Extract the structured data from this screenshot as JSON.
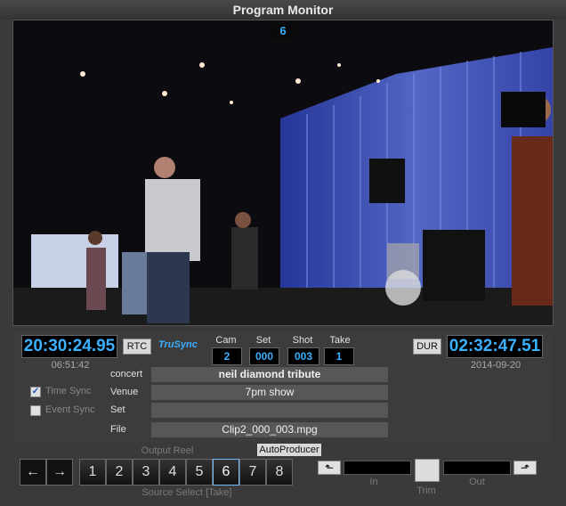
{
  "window": {
    "title": "Program Monitor"
  },
  "video": {
    "active_camera": "6"
  },
  "timecode": {
    "current": "20:30:24.95",
    "elapsed": "06:51:42",
    "rtc_label": "RTC",
    "trusync_label": "TruSync",
    "dur_label": "DUR",
    "duration": "02:32:47.51",
    "date": "2014-09-20"
  },
  "take": {
    "cam_label": "Cam",
    "cam": "2",
    "set_label": "Set",
    "set": "000",
    "shot_label": "Shot",
    "shot": "003",
    "take_label": "Take",
    "take": "1"
  },
  "metadata": {
    "concert_label": "concert",
    "concert": "neil diamond tribute",
    "venue_label": "Venue",
    "venue": "7pm show",
    "set_label": "Set",
    "set": "",
    "file_label": "File",
    "file": "Clip2_000_003.mpg"
  },
  "sync": {
    "time_sync_label": "Time Sync",
    "time_sync_checked": true,
    "event_sync_label": "Event Sync",
    "event_sync_checked": false
  },
  "controls": {
    "prev_glyph": "←",
    "next_glyph": "→",
    "output_reel_label": "Output Reel",
    "autoproducer_label": "AutoProducer",
    "source_select_label": "Source Select [Take]",
    "sources": [
      "1",
      "2",
      "3",
      "4",
      "5",
      "6",
      "7",
      "8"
    ],
    "active_source": "6",
    "in_label": "In",
    "trim_label": "Trim",
    "out_label": "Out"
  },
  "colors": {
    "accent": "#3ab0ff",
    "background": "#3a3a3a"
  }
}
